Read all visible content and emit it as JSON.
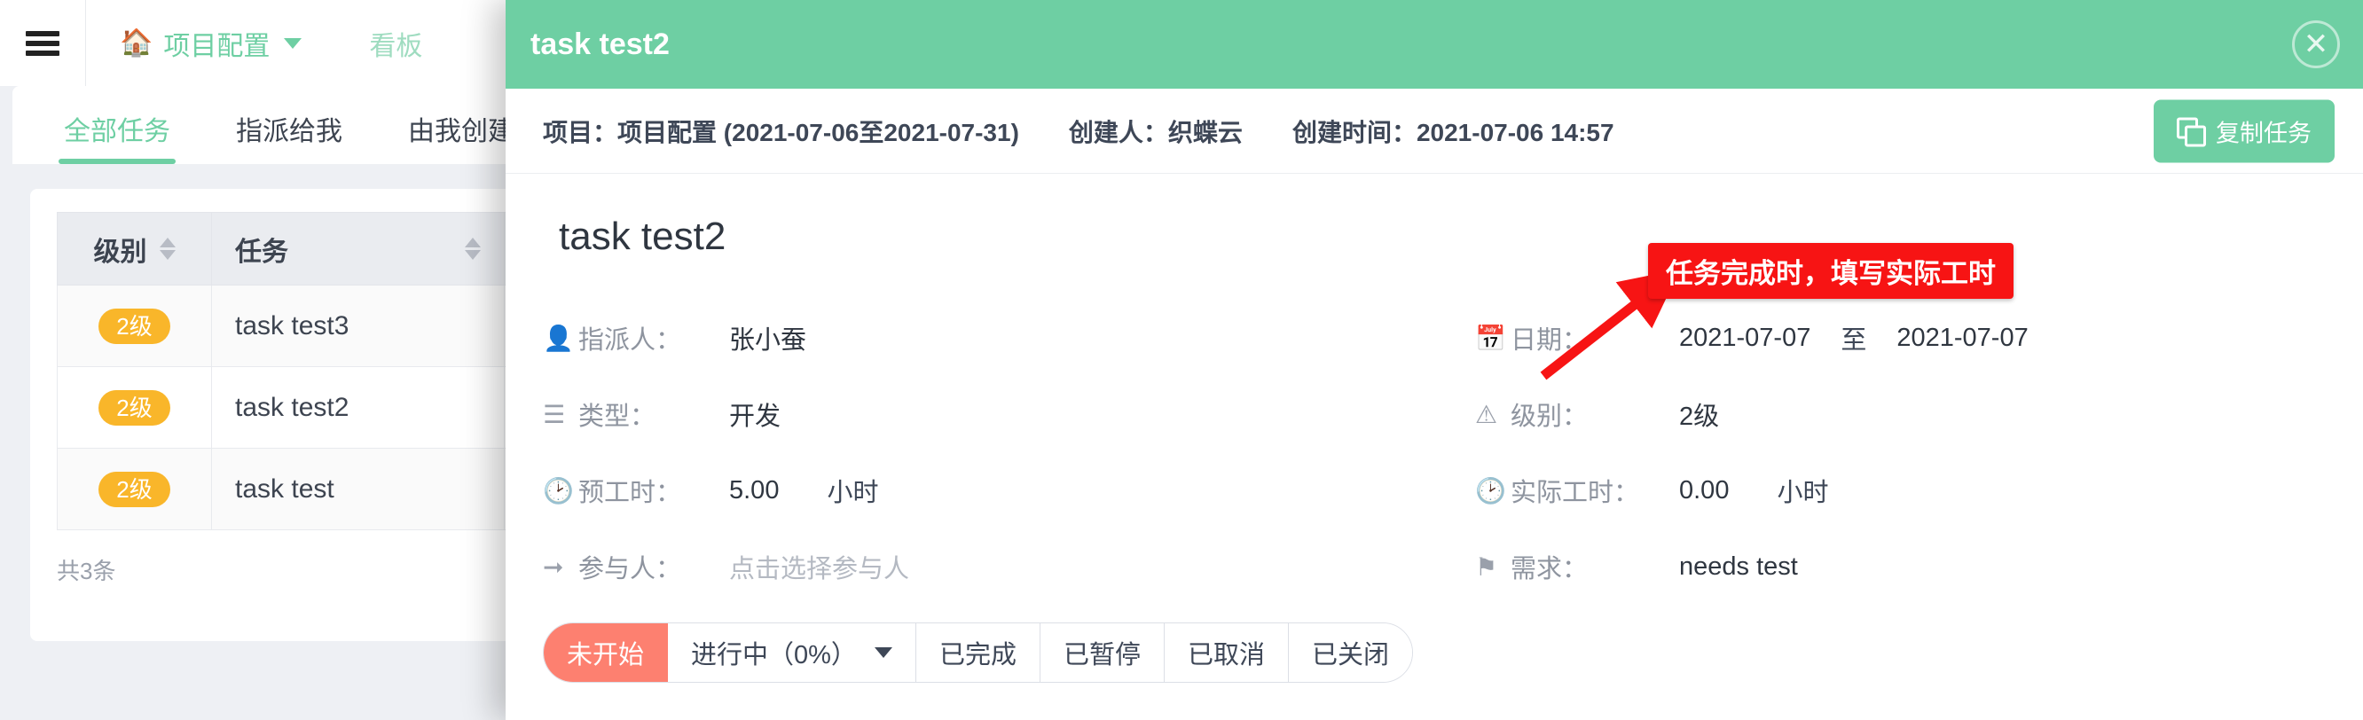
{
  "background": {
    "topnav": {
      "menu_icon": "hamburger-icon",
      "items": [
        {
          "label": "项目配置",
          "icon": "home-icon",
          "has_caret": true,
          "active": true
        },
        {
          "label": "看板",
          "icon": "",
          "has_caret": false,
          "active": false
        }
      ]
    },
    "tabs": [
      {
        "label": "全部任务",
        "active": true
      },
      {
        "label": "指派给我",
        "active": false
      },
      {
        "label": "由我创建",
        "active": false
      }
    ],
    "table": {
      "columns": [
        {
          "label": "级别",
          "sortable": true
        },
        {
          "label": "任务",
          "sortable": true
        },
        {
          "label": "",
          "sortable": false
        }
      ],
      "rows": [
        {
          "level": "2级",
          "task": "task test3"
        },
        {
          "level": "2级",
          "task": "task test2"
        },
        {
          "level": "2级",
          "task": "task test"
        }
      ],
      "footer_count": "共3条"
    }
  },
  "modal": {
    "header_title": "task test2",
    "close_icon": "close-circle-icon",
    "meta": {
      "project_label": "项目：",
      "project_value": "项目配置 (2021-07-06至2021-07-31)",
      "creator_label": "创建人：",
      "creator_value": "织蝶云",
      "created_label": "创建时间：",
      "created_value": "2021-07-06 14:57"
    },
    "copy_button": {
      "label": "复制任务",
      "icon": "copy-icon"
    },
    "task_title": "task test2",
    "fields_left": [
      {
        "icon": "user-icon",
        "label": "指派人：",
        "value": "张小蚕",
        "placeholder": false
      },
      {
        "icon": "list-icon",
        "label": "类型：",
        "value": "开发",
        "placeholder": false
      },
      {
        "icon": "clock-icon",
        "label": "预工时：",
        "value": "5.00",
        "unit": "小时",
        "placeholder": false
      },
      {
        "icon": "exit-icon",
        "label": "参与人：",
        "value": "点击选择参与人",
        "placeholder": true
      }
    ],
    "fields_right": [
      {
        "icon": "calendar-icon",
        "label": "日期：",
        "value": "2021-07-07",
        "separator": "至",
        "value2": "2021-07-07"
      },
      {
        "icon": "info-icon",
        "label": "级别：",
        "value": "2级"
      },
      {
        "icon": "clock-icon",
        "label": "实际工时：",
        "value": "0.00",
        "unit": "小时"
      },
      {
        "icon": "flag-icon",
        "label": "需求：",
        "value": "needs test"
      }
    ],
    "annotation": {
      "text": "任务完成时，填写实际工时",
      "color": "#f71414"
    },
    "status_buttons": [
      {
        "label": "未开始",
        "active": true,
        "dropdown": false
      },
      {
        "label": "进行中（0%）",
        "active": false,
        "dropdown": true
      },
      {
        "label": "已完成",
        "active": false,
        "dropdown": false
      },
      {
        "label": "已暂停",
        "active": false,
        "dropdown": false
      },
      {
        "label": "已取消",
        "active": false,
        "dropdown": false
      },
      {
        "label": "已关闭",
        "active": false,
        "dropdown": false
      }
    ]
  },
  "colors": {
    "brand_green": "#6ecfa3",
    "badge_orange": "#f9b62a",
    "status_active": "#fd8070",
    "annotation_red": "#f71414"
  }
}
